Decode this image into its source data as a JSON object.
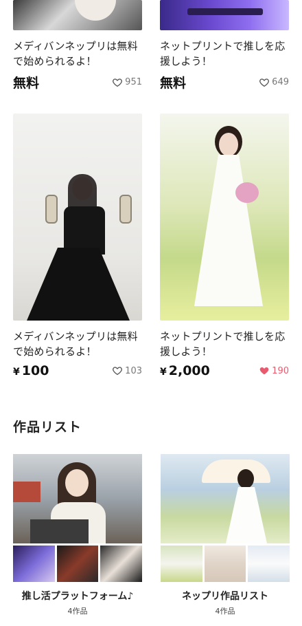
{
  "items": [
    {
      "title": "メディバンネップリは無料で始められるよ！",
      "price": "無料",
      "likes": "951",
      "liked": false
    },
    {
      "title": "ネットプリントで推しを応援しよう！",
      "price": "無料",
      "likes": "649",
      "liked": false
    },
    {
      "title": "メディバンネップリは無料で始められるよ！",
      "currency": "¥",
      "price": "100",
      "likes": "103",
      "liked": false
    },
    {
      "title": "ネットプリントで推しを応援しよう！",
      "currency": "¥",
      "price": "2,000",
      "likes": "190",
      "liked": true
    }
  ],
  "section_title": "作品リスト",
  "lists": [
    {
      "name": "推し活プラットフォーム♪",
      "count": "4作品"
    },
    {
      "name": "ネップリ作品リスト",
      "count": "4作品"
    }
  ],
  "colors": {
    "like_active": "#e85a6e",
    "like_idle": "#777777"
  },
  "icons": {
    "like": "heart-outline-icon",
    "liked": "heart-filled-icon"
  }
}
